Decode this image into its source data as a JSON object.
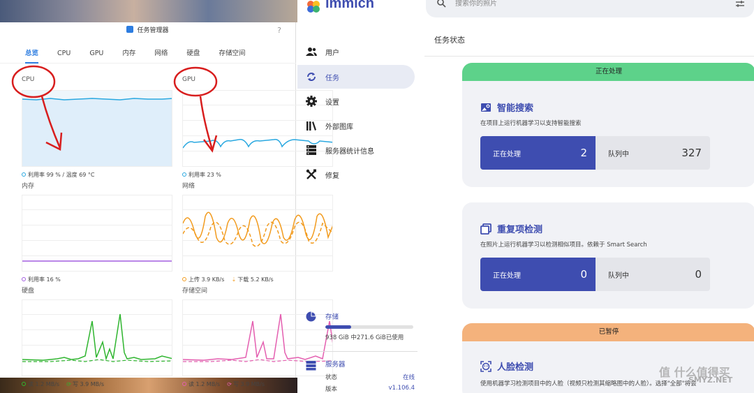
{
  "task_manager": {
    "title": "任务管理器",
    "help": "?",
    "tabs": [
      "总览",
      "CPU",
      "GPU",
      "内存",
      "网络",
      "硬盘",
      "存储空间"
    ],
    "panels": {
      "cpu": {
        "title": "CPU",
        "legend": "利用率 99 % / 温度 69 °C",
        "color": "#29a8e0"
      },
      "gpu": {
        "title": "GPU",
        "legend": "利用率 23 %",
        "color": "#29a8e0"
      },
      "memory": {
        "title": "内存",
        "legend": "利用率 16 %",
        "color": "#a35fe0"
      },
      "network": {
        "title": "网络",
        "upload": "上传 3.9 KB/s",
        "download": "下载 5.2 KB/s",
        "color": "#f29b1e"
      },
      "disk": {
        "title": "硬盘",
        "read": "读 1.2 MB/s",
        "write": "写 3.9 MB/s",
        "color": "#2fb52f"
      },
      "storage": {
        "title": "存储空间",
        "read": "读 1.2 MB/s",
        "write": "写 3.9 MB/s",
        "color": "#e45fb0"
      }
    }
  },
  "immich": {
    "logo": "immich",
    "search_placeholder": "搜索你的照片",
    "nav": [
      {
        "label": "用户",
        "icon": "users-icon"
      },
      {
        "label": "任务",
        "icon": "sync-icon",
        "active": true
      },
      {
        "label": "设置",
        "icon": "gear-icon"
      },
      {
        "label": "外部图库",
        "icon": "library-icon"
      },
      {
        "label": "服务器统计信息",
        "icon": "server-icon"
      },
      {
        "label": "修复",
        "icon": "tools-icon"
      }
    ],
    "storage": {
      "label": "存储",
      "text": "938 GiB 中271.6 GiB已使用",
      "used_fraction": 0.29
    },
    "server": {
      "label": "服务器",
      "status_label": "状态",
      "status_value": "在线",
      "version_label": "版本",
      "version_value": "v1.106.4"
    },
    "main_title": "任务状态",
    "jobs": [
      {
        "status": "正在处理",
        "title": "智能搜索",
        "desc": "在项目上运行机器学习以支持智能搜索",
        "active_label": "正在处理",
        "active_count": "2",
        "queue_label": "队列中",
        "queue_count": "327"
      },
      {
        "title": "重复项检测",
        "desc": "在照片上运行机器学习以检测相似项目。依赖于 Smart Search",
        "active_label": "正在处理",
        "active_count": "0",
        "queue_label": "队列中",
        "queue_count": "0"
      },
      {
        "status": "已暂停",
        "title": "人脸检测",
        "desc": "使用机器学习检测项目中的人脸（视频只检测其缩略图中的人脸）。选择\"全部\"将会"
      }
    ]
  },
  "watermark": {
    "text": "值 什么值得买",
    "sub": "SMYZ.NET"
  }
}
